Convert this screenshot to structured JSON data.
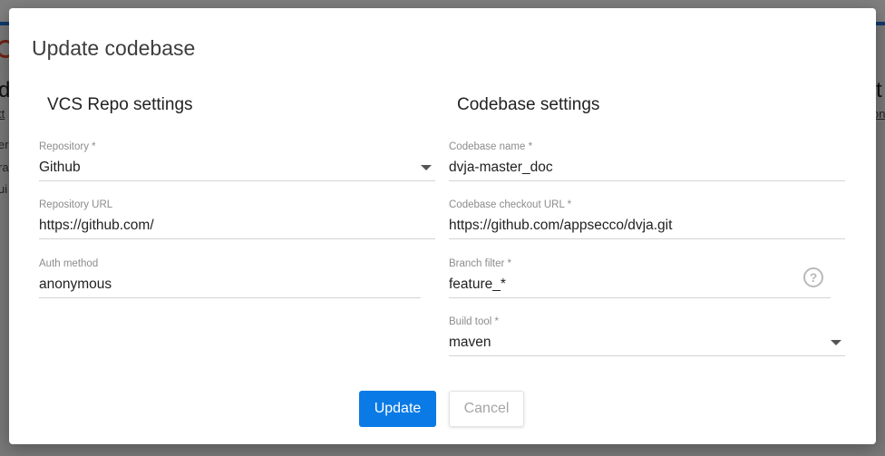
{
  "background": {
    "left_text": "dv",
    "left_link": "tt",
    "left_lines": [
      "er",
      "ra",
      "ui"
    ],
    "right_text": "st",
    "right_link": "on"
  },
  "dialog": {
    "title": "Update codebase",
    "vcs_section": {
      "title": "VCS Repo settings",
      "repository": {
        "label": "Repository *",
        "value": "Github"
      },
      "repository_url": {
        "label": "Repository URL",
        "value": "https://github.com/"
      },
      "auth_method": {
        "label": "Auth method",
        "value": "anonymous"
      }
    },
    "codebase_section": {
      "title": "Codebase settings",
      "codebase_name": {
        "label": "Codebase name *",
        "value": "dvja-master_doc"
      },
      "checkout_url": {
        "label": "Codebase checkout URL *",
        "value": "https://github.com/appsecco/dvja.git"
      },
      "branch_filter": {
        "label": "Branch filter *",
        "value": "feature_*"
      },
      "help_icon": "?",
      "build_tool": {
        "label": "Build tool *",
        "value": "maven"
      }
    },
    "buttons": {
      "update": "Update",
      "cancel": "Cancel"
    }
  }
}
